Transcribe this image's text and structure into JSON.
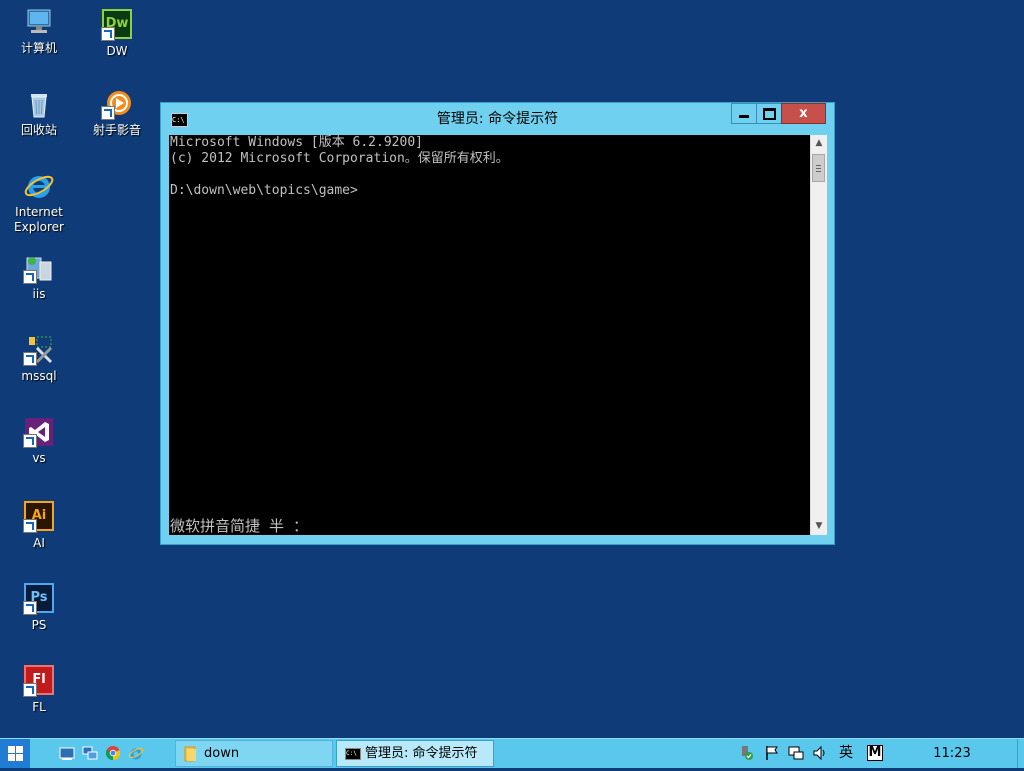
{
  "desktop": {
    "icons": [
      {
        "label": "计算机"
      },
      {
        "label": "DW"
      },
      {
        "label": "回收站"
      },
      {
        "label": "射手影音"
      },
      {
        "label": "Internet Explorer"
      },
      {
        "label": "iis"
      },
      {
        "label": "mssql"
      },
      {
        "label": "vs"
      },
      {
        "label": "AI"
      },
      {
        "label": "PS"
      },
      {
        "label": "FL"
      }
    ]
  },
  "window": {
    "title": "管理员: 命令提示符",
    "icon": "cmd-icon",
    "buttons": {
      "minimize": "minimize-icon",
      "maximize": "maximize-icon",
      "close": "close-icon"
    },
    "console_lines": [
      "Microsoft Windows [版本 6.2.9200]",
      "(c) 2012 Microsoft Corporation。保留所有权利。",
      "",
      "D:\\down\\web\\topics\\game>"
    ],
    "ime_status": "微软拼音简捷 半 ：",
    "scrollbar": {
      "up": "▲",
      "down": "▼"
    }
  },
  "taskbar": {
    "start_icon": "windows-logo-icon",
    "quick_launch": [
      "show-desktop-icon",
      "network-computer-icon",
      "chrome-icon",
      "ie-icon"
    ],
    "tasks": [
      {
        "label": "down",
        "icon": "folder-icon"
      },
      {
        "label": "管理员: 命令提示符",
        "icon": "cmd-icon"
      }
    ],
    "tray": {
      "icons": [
        "usb-safe-remove-icon",
        "flag-icon",
        "network-icon",
        "volume-icon"
      ],
      "ime_lang": "英",
      "ime_mode": "M",
      "clock": "11:23"
    }
  },
  "colors": {
    "desktop_bg": "#0f3c78",
    "window_frame": "#6fd0ef",
    "close_button": "#c7514a",
    "taskbar": "#5ac8ec",
    "console_bg": "#000000",
    "console_fg": "#c0c0c0"
  }
}
